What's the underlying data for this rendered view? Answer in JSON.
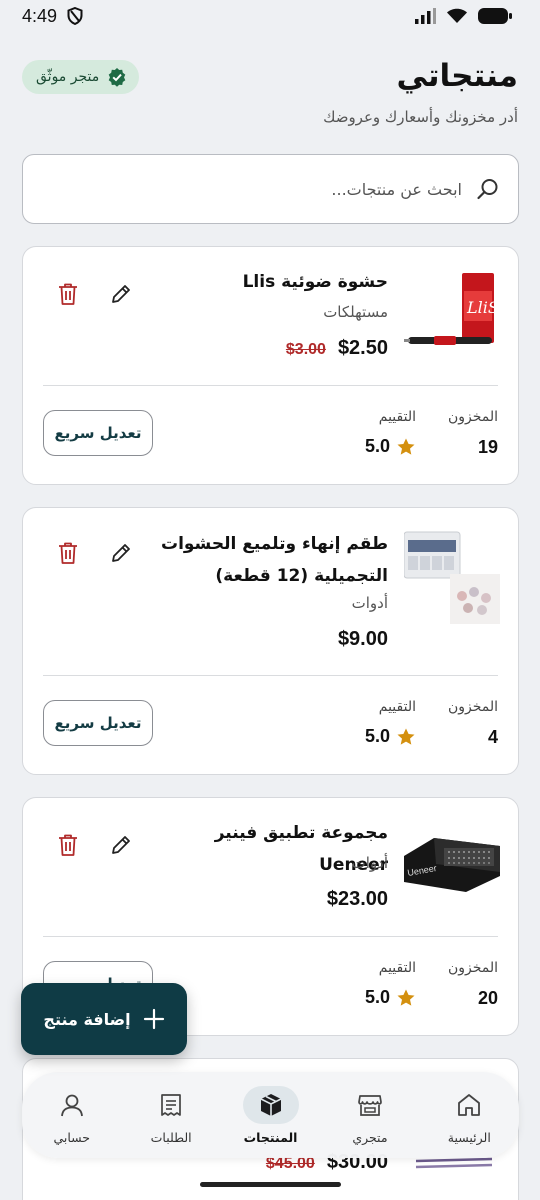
{
  "status_bar": {
    "time": "4:49"
  },
  "header": {
    "title": "منتجاتي",
    "subtitle": "أدر مخزونك وأسعارك وعروضك",
    "verified_badge": "متجر موثّق"
  },
  "search": {
    "placeholder": "ابحث عن منتجات..."
  },
  "products": [
    {
      "name": "حشوة ضوئية Llis",
      "category": "مستهلكات",
      "price": "$2.50",
      "old_price": "$3.00",
      "stock_label": "المخزون",
      "stock": "19",
      "rating_label": "التقييم",
      "rating": "5.0",
      "quick_edit": "تعديل سريع"
    },
    {
      "name": "طقم إنهاء وتلميع الحشوات التجميلية (12 قطعة)",
      "category": "أدوات",
      "price": "$9.00",
      "old_price": "",
      "stock_label": "المخزون",
      "stock": "4",
      "rating_label": "التقييم",
      "rating": "5.0",
      "quick_edit": "تعديل سريع"
    },
    {
      "name": "مجموعة تطبيق فينير Ueneer",
      "category": "أدوات",
      "price": "$23.00",
      "old_price": "",
      "stock_label": "المخزون",
      "stock": "20",
      "rating_label": "التقييم",
      "rating": "5.0",
      "quick_edit": "تعديل سريع"
    },
    {
      "price": "$30.00",
      "old_price": "$45.00"
    }
  ],
  "fab": {
    "label": "إضافة منتج"
  },
  "nav": [
    {
      "label": "الرئيسية",
      "icon": "home-icon",
      "active": false
    },
    {
      "label": "متجري",
      "icon": "store-icon",
      "active": false
    },
    {
      "label": "المنتجات",
      "icon": "box-icon",
      "active": true
    },
    {
      "label": "الطلبات",
      "icon": "receipt-icon",
      "active": false
    },
    {
      "label": "حسابي",
      "icon": "user-icon",
      "active": false
    }
  ],
  "colors": {
    "primary": "#0f3b45",
    "danger": "#b02a2a",
    "star": "#d4900f",
    "badge_bg": "#d5eadd",
    "badge_check": "#1f6b45",
    "background": "#eef0f3"
  }
}
